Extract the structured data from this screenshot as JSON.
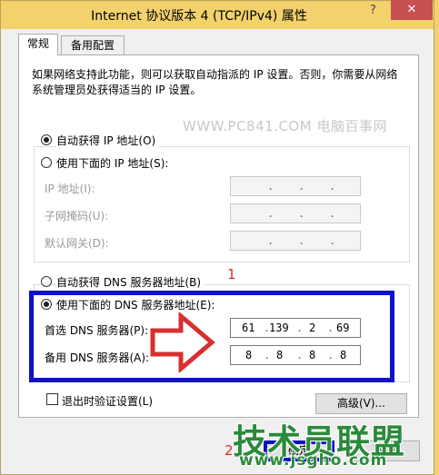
{
  "window": {
    "title": "Internet 协议版本 4 (TCP/IPv4) 属性",
    "help": "?",
    "close": "✕"
  },
  "tabs": [
    {
      "label": "常规",
      "active": true
    },
    {
      "label": "备用配置",
      "active": false
    }
  ],
  "description": "如果网络支持此功能，则可以获取自动指派的 IP 设置。否则，你需要从网络系统管理员处获得适当的 IP 设置。",
  "watermark": "WWW.PC841.COM 电脑百事网",
  "ip_section": {
    "auto_label": "自动获得 IP 地址(O)",
    "manual_label": "使用下面的 IP 地址(S):",
    "auto_selected": true,
    "fields": [
      {
        "label": "IP 地址(I):",
        "value": [
          "",
          "",
          "",
          ""
        ]
      },
      {
        "label": "子网掩码(U):",
        "value": [
          "",
          "",
          "",
          ""
        ]
      },
      {
        "label": "默认网关(D):",
        "value": [
          "",
          "",
          "",
          ""
        ]
      }
    ]
  },
  "dns_section": {
    "auto_label": "自动获得 DNS 服务器地址(B)",
    "manual_label": "使用下面的 DNS 服务器地址(E):",
    "manual_selected": true,
    "fields": [
      {
        "label": "首选 DNS 服务器(P):",
        "value": [
          "61",
          "139",
          "2",
          "69"
        ]
      },
      {
        "label": "备用 DNS 服务器(A):",
        "value": [
          "8",
          "8",
          "8",
          "8"
        ]
      }
    ]
  },
  "validate_label": "退出时验证设置(L)",
  "validate_checked": false,
  "buttons": {
    "advanced": "高级(V)...",
    "ok": "确定",
    "cancel": "取消"
  },
  "annotations": {
    "step1": "1",
    "step2": "2"
  },
  "logo": {
    "text": "技术员联盟",
    "url": "www.jsgho.com"
  },
  "colors": {
    "titlebar": "#f3d26d",
    "highlight": "#1010c8",
    "arrow": "#d83030",
    "close": "#c75050"
  }
}
